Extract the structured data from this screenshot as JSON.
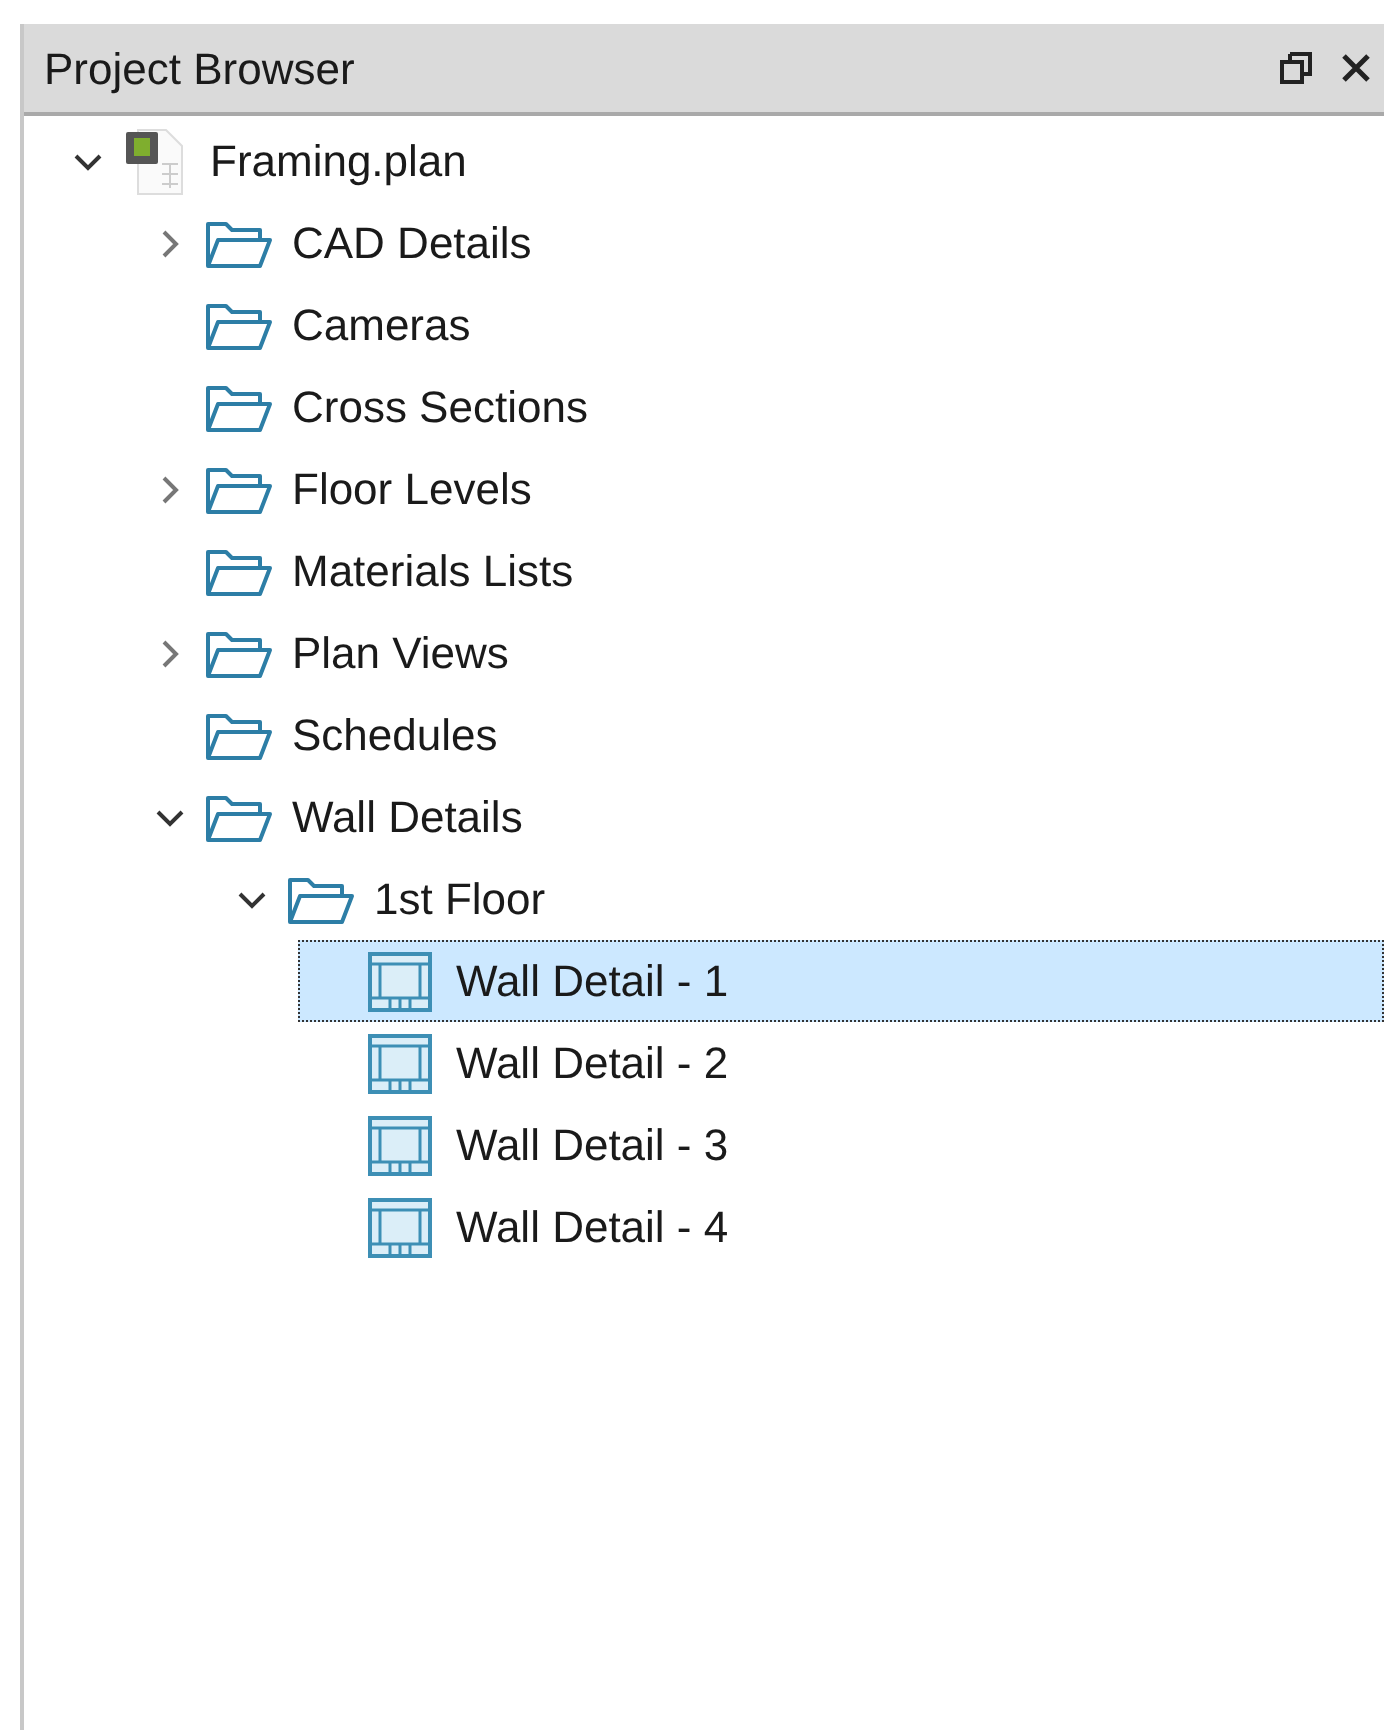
{
  "panel": {
    "title": "Project Browser"
  },
  "tree": [
    {
      "label": "Framing.plan",
      "kind": "file",
      "expandable": true,
      "expanded": true,
      "selected": false,
      "children": [
        {
          "label": "CAD Details",
          "kind": "folder",
          "expandable": true,
          "expanded": false,
          "selected": false
        },
        {
          "label": "Cameras",
          "kind": "folder",
          "expandable": false,
          "selected": false
        },
        {
          "label": "Cross Sections",
          "kind": "folder",
          "expandable": false,
          "selected": false
        },
        {
          "label": "Floor Levels",
          "kind": "folder",
          "expandable": true,
          "expanded": false,
          "selected": false
        },
        {
          "label": "Materials Lists",
          "kind": "folder",
          "expandable": false,
          "selected": false
        },
        {
          "label": "Plan Views",
          "kind": "folder",
          "expandable": true,
          "expanded": false,
          "selected": false
        },
        {
          "label": "Schedules",
          "kind": "folder",
          "expandable": false,
          "selected": false
        },
        {
          "label": "Wall Details",
          "kind": "folder",
          "expandable": true,
          "expanded": true,
          "selected": false,
          "children": [
            {
              "label": "1st Floor",
              "kind": "folder",
              "expandable": true,
              "expanded": true,
              "selected": false,
              "children": [
                {
                  "label": "Wall Detail - 1",
                  "kind": "view",
                  "expandable": false,
                  "selected": true
                },
                {
                  "label": "Wall Detail - 2",
                  "kind": "view",
                  "expandable": false,
                  "selected": false
                },
                {
                  "label": "Wall Detail - 3",
                  "kind": "view",
                  "expandable": false,
                  "selected": false
                },
                {
                  "label": "Wall Detail - 4",
                  "kind": "view",
                  "expandable": false,
                  "selected": false
                }
              ]
            }
          ]
        }
      ]
    }
  ]
}
